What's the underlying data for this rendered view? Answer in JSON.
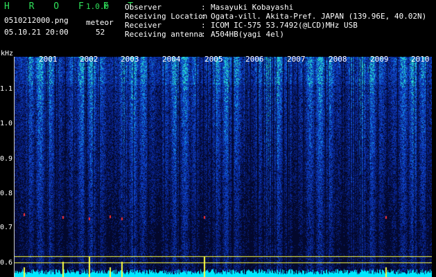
{
  "header": {
    "app_title": "H R O F F T",
    "version": "1.0.0",
    "file_name": "0510212000.png",
    "datetime": "05.10.21 20:00",
    "meteor_label": "meteor",
    "meteor_count": "52"
  },
  "meta": [
    {
      "label": "Observer",
      "value": "Masayuki Kobayashi"
    },
    {
      "label": "Receiving Location",
      "value": "Ogata-vill. Akita-Pref. JAPAN (139.96E, 40.02N)"
    },
    {
      "label": "Receiver",
      "value": "ICOM IC-575 53.7492(@LCD)MHz USB"
    },
    {
      "label": "Receiving antenna",
      "value": "A504HB(yagi 4el)"
    }
  ],
  "axis": {
    "unit": "kHz",
    "y_ticks": [
      "1.1",
      "1.0",
      "0.9",
      "0.8",
      "0.7",
      "0.6"
    ],
    "x_labels": [
      "2001",
      "2002",
      "2003",
      "2004",
      "2005",
      "2006",
      "2007",
      "2008",
      "2009",
      "2010"
    ]
  },
  "colors": {
    "background": "#000000",
    "header_accent": "#2fe05a",
    "spectrum_base": "#0a1a6a",
    "meteor_mark": "#ff3030",
    "level_bar": "#00e8ff",
    "peak_bar": "#ffff40"
  }
}
